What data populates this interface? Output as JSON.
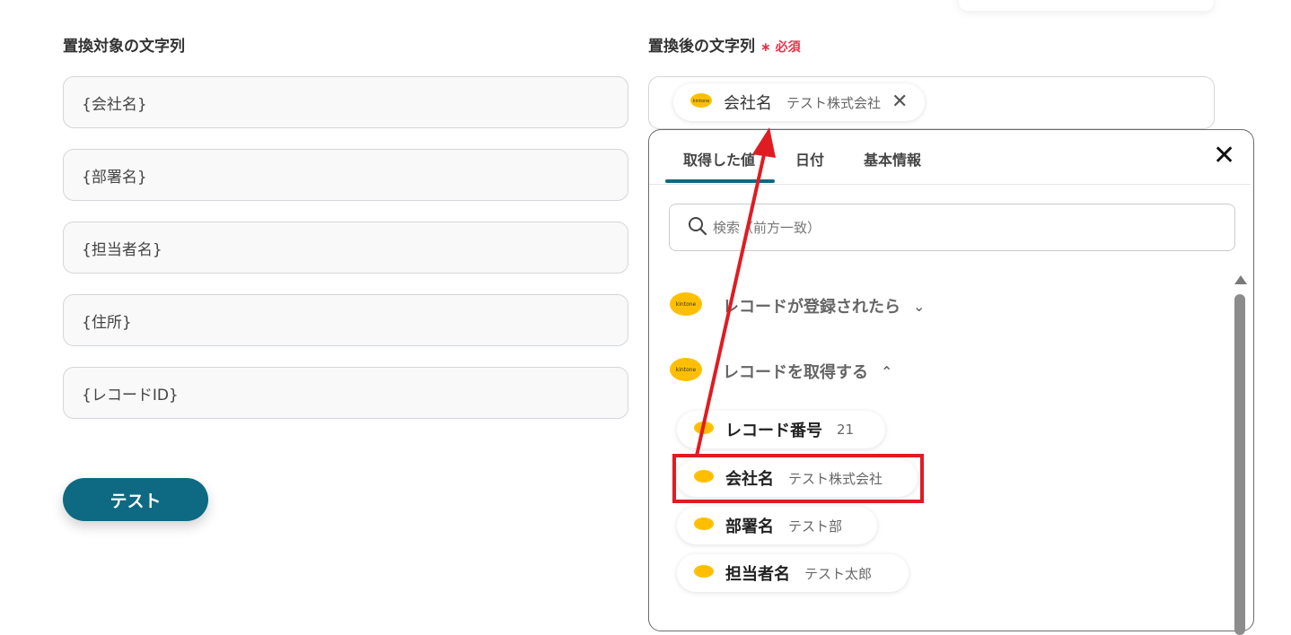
{
  "left_column": {
    "label": "置換対象の文字列",
    "fields": [
      "{会社名}",
      "{部署名}",
      "{担当者名}",
      "{住所}",
      "{レコードID}"
    ],
    "test_button": "テスト"
  },
  "right_column": {
    "label": "置換後の文字列",
    "required_mark": "∗",
    "required_text": "必須",
    "selected_pill": {
      "label": "会社名",
      "value": "テスト株式会社",
      "remove_icon": "close-icon"
    }
  },
  "picker": {
    "tabs": [
      "取得した値",
      "日付",
      "基本情報"
    ],
    "active_tab": "取得した値",
    "close_icon": "close-icon",
    "search_placeholder": "検索（前方一致）",
    "logo_text": "kintone",
    "sections": [
      {
        "title": "レコードが登録されたら",
        "expanded": false
      },
      {
        "title": "レコードを取得する",
        "expanded": true
      }
    ],
    "items": [
      {
        "label": "レコード番号",
        "value": "21"
      },
      {
        "label": "会社名",
        "value": "テスト株式会社",
        "highlighted": true
      },
      {
        "label": "部署名",
        "value": "テスト部"
      },
      {
        "label": "担当者名",
        "value": "テスト太郎"
      }
    ]
  },
  "colors": {
    "primary": "#0e6a82",
    "required": "#e5334b",
    "highlight": "#e01c22",
    "kintone_yellow": "#ffbf00"
  }
}
